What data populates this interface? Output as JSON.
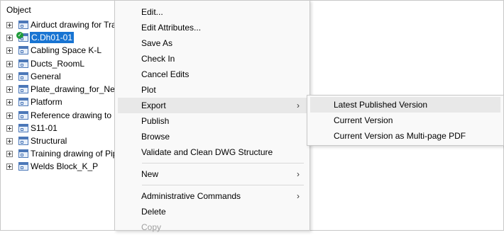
{
  "tree": {
    "header": "Object",
    "items": [
      {
        "label": "Airduct drawing for Tra"
      },
      {
        "label": "C.Dh01-01"
      },
      {
        "label": "Cabling Space K-L"
      },
      {
        "label": "Ducts_RoomL"
      },
      {
        "label": "General"
      },
      {
        "label": "Plate_drawing_for_Nes"
      },
      {
        "label": "Platform"
      },
      {
        "label": "Reference drawing to D"
      },
      {
        "label": "S11-01"
      },
      {
        "label": "Structural"
      },
      {
        "label": "Training drawing of Pip"
      },
      {
        "label": "Welds Block_K_P"
      }
    ]
  },
  "context_menu": {
    "items": [
      {
        "label": "Edit..."
      },
      {
        "label": "Edit Attributes..."
      },
      {
        "label": "Save As"
      },
      {
        "label": "Check In"
      },
      {
        "label": "Cancel Edits"
      },
      {
        "label": "Plot"
      },
      {
        "label": "Export",
        "arrow": "›"
      },
      {
        "label": "Publish"
      },
      {
        "label": "Browse"
      },
      {
        "label": "Validate and Clean DWG Structure"
      },
      {
        "label": "New",
        "arrow": "›"
      },
      {
        "label": "Administrative Commands",
        "arrow": "›"
      },
      {
        "label": "Delete"
      },
      {
        "label": "Copy"
      }
    ]
  },
  "export_submenu": {
    "items": [
      {
        "label": "Latest Published Version"
      },
      {
        "label": "Current Version"
      },
      {
        "label": "Current Version as Multi-page PDF"
      }
    ]
  },
  "colors": {
    "selection": "#1874d2",
    "menu_background": "#f9f9f9",
    "menu_highlight": "#e8e8e8"
  },
  "icons": {
    "expander": "plus-box-icon",
    "drawing": "drawing-document-icon",
    "checked_out": "green-check-icon",
    "submenu": "chevron-right-icon"
  }
}
